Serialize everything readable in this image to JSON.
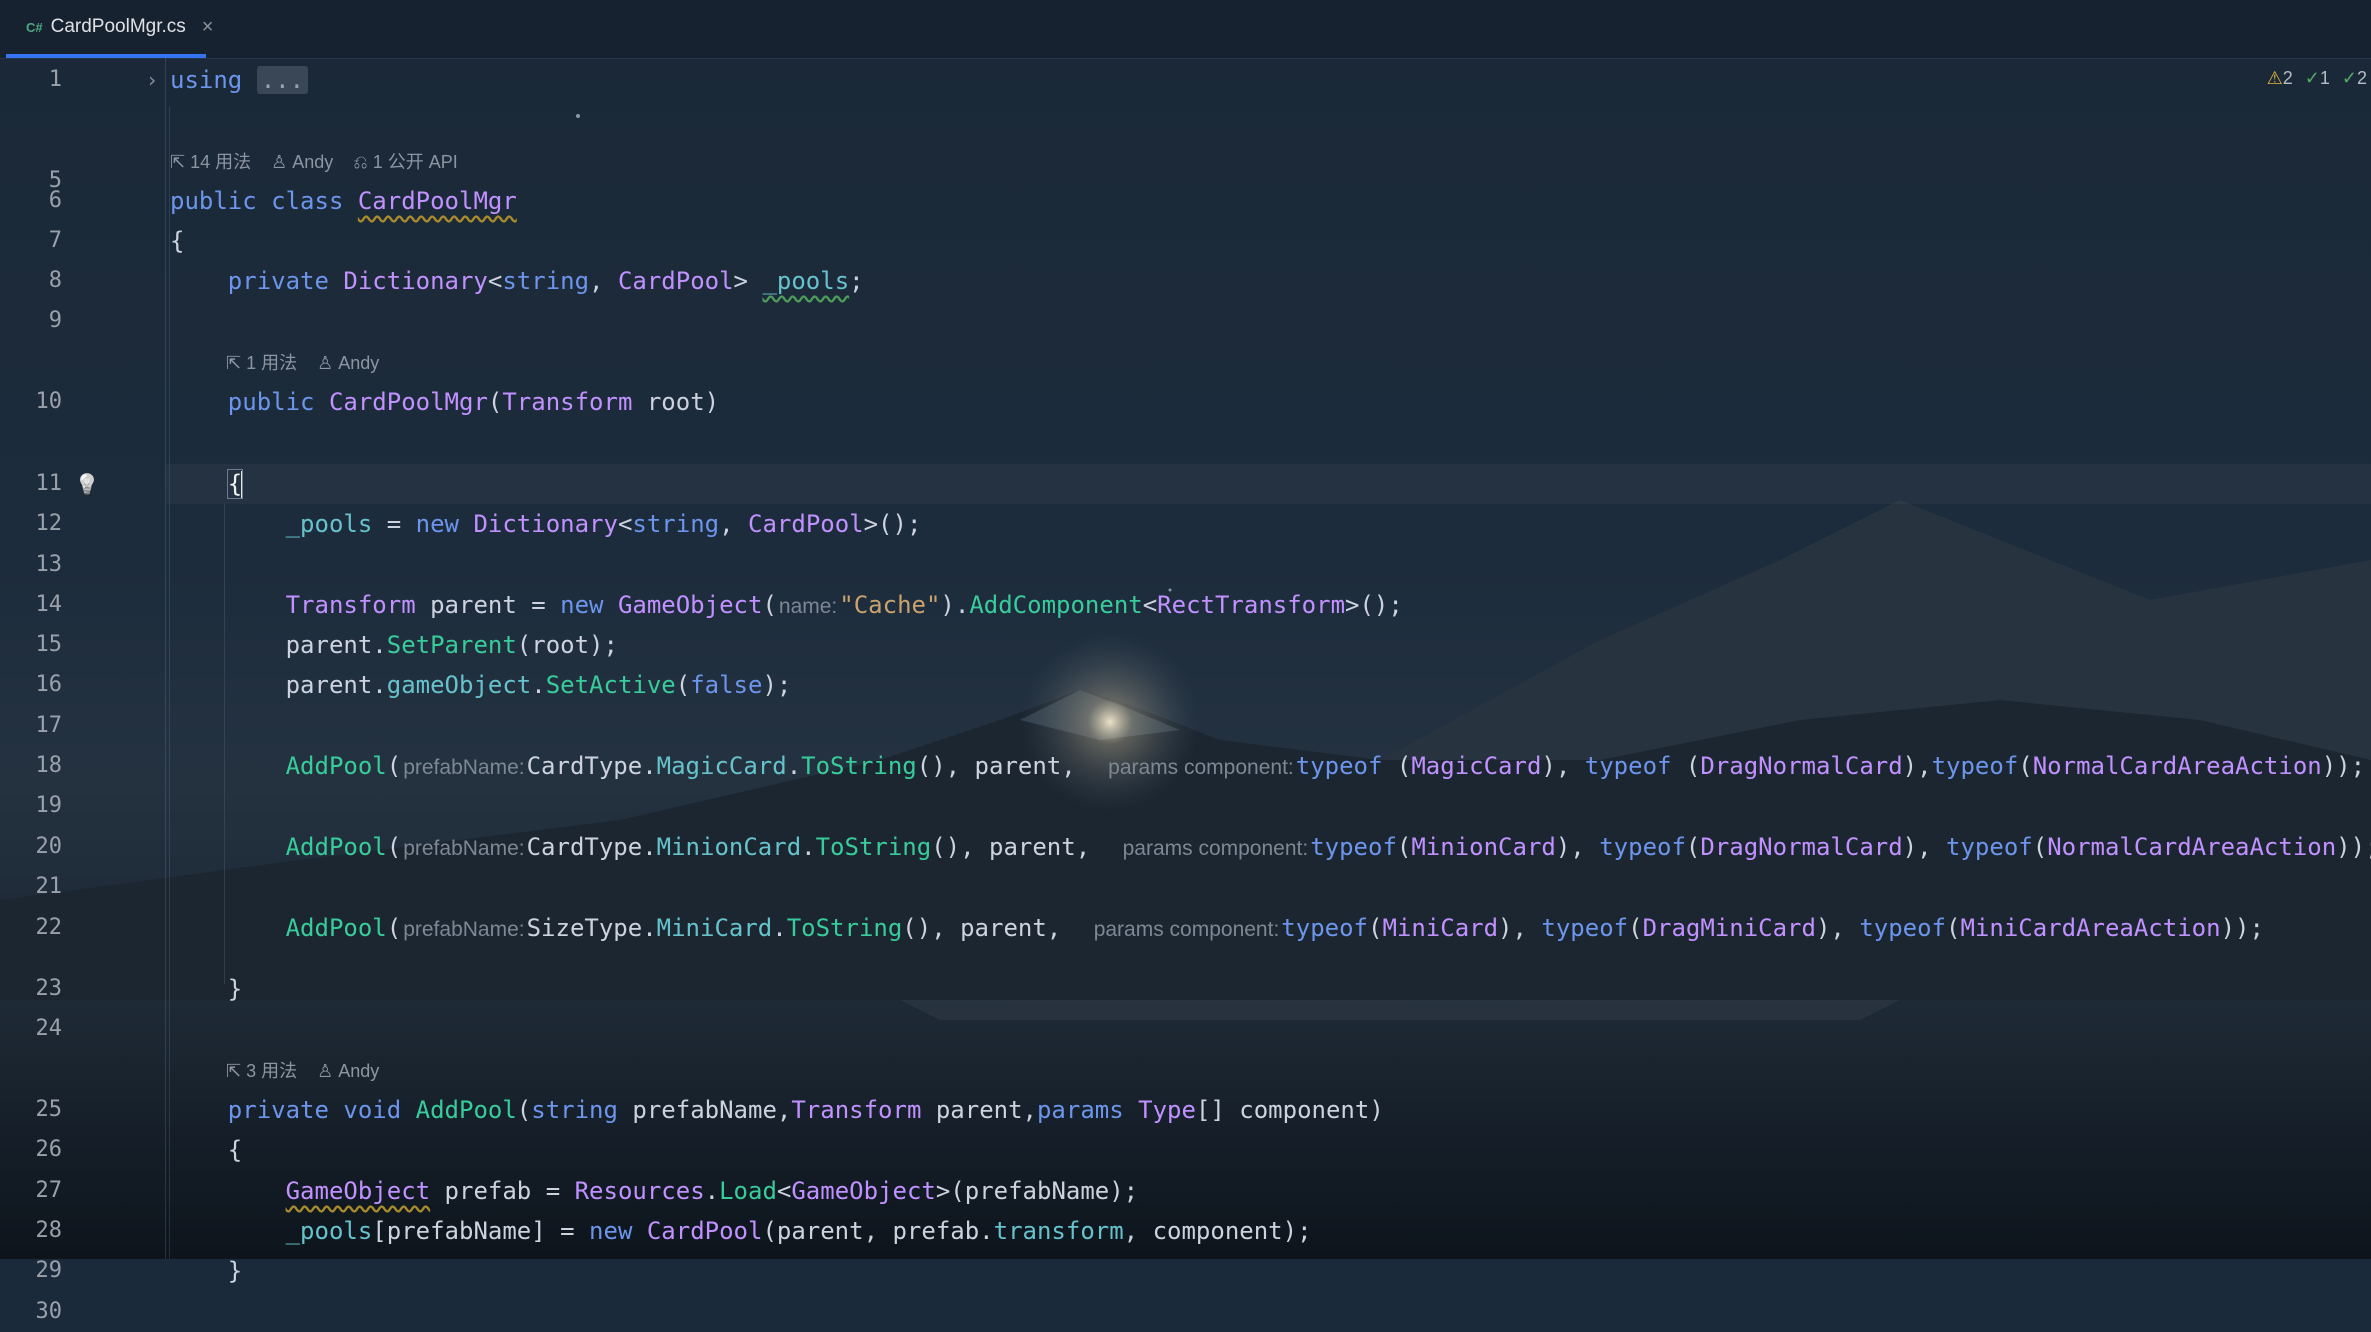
{
  "tab": {
    "icon": "C#",
    "filename": "CardPoolMgr.cs",
    "close": "×"
  },
  "inspections": {
    "warnings": "2",
    "weak_warnings": "1",
    "typos": "2"
  },
  "gutter": {
    "line_numbers": [
      "1",
      "5",
      "6",
      "7",
      "8",
      "9",
      "10",
      "11",
      "12",
      "13",
      "14",
      "15",
      "16",
      "17",
      "18",
      "19",
      "20",
      "21",
      "22",
      "23",
      "24",
      "25",
      "26",
      "27",
      "28",
      "29",
      "30"
    ]
  },
  "hints": {
    "class_usages": "14 用法",
    "class_author": "Andy",
    "class_api": "1 公开 API",
    "ctor_usages": "1 用法",
    "ctor_author": "Andy",
    "addpool_usages": "3 用法",
    "addpool_author": "Andy"
  },
  "code": {
    "l1_kw": "using",
    "l1_fold": "...",
    "l6_mod": "public class ",
    "l6_name": "CardPoolMgr",
    "l7": "{",
    "l8_mod": "private ",
    "l8_type": "Dictionary",
    "l8_rest1": "<",
    "l8_t1": "string",
    "l8_rest2": ", ",
    "l8_t2": "CardPool",
    "l8_rest3": "> ",
    "l8_field": "_pools",
    "l8_end": ";",
    "l10_mod": "public ",
    "l10_name": "CardPoolMgr",
    "l10_p": "(",
    "l10_ptype": "Transform",
    "l10_rest": " root)",
    "l11": "{",
    "l12_field": "_pools",
    "l12_eq": " = ",
    "l12_new": "new ",
    "l12_type": "Dictionary",
    "l12_lt": "<",
    "l12_t1": "string",
    "l12_comma": ", ",
    "l12_t2": "CardPool",
    "l12_end": ">();",
    "l14_type": "Transform",
    "l14_a": " parent = ",
    "l14_new": "new ",
    "l14_go": "GameObject",
    "l14_p": "(",
    "l14_hint": "name:",
    "l14_str": "\"Cache\"",
    "l14_b": ").",
    "l14_fn": "AddComponent",
    "l14_lt": "<",
    "l14_rt": "RectTransform",
    "l14_end": ">();",
    "l15_a": "parent.",
    "l15_fn": "SetParent",
    "l15_end": "(root);",
    "l16_a": "parent.",
    "l16_fld": "gameObject",
    "l16_dot": ".",
    "l16_fn": "SetActive",
    "l16_p": "(",
    "l16_kw": "false",
    "l16_end": ");",
    "l18_fn": "AddPool",
    "l18_p": "(",
    "l18_hint": "prefabName:",
    "l18_a": "CardType.",
    "l18_enum": "MagicCard",
    "l18_dot": ".",
    "l18_ts": "ToString",
    "l18_b": "(), parent, ",
    "l18_hint2": "params component:",
    "l18_to1": "typeof",
    "l18_c1": " (",
    "l18_t1": "MagicCard",
    "l18_c2": "), ",
    "l18_to2": "typeof",
    "l18_c3": " (",
    "l18_t2": "DragNormalCard",
    "l18_c4": "),",
    "l18_to3": "typeof",
    "l18_c5": "(",
    "l18_t3": "NormalCardAreaAction",
    "l18_end": "));",
    "l20_fn": "AddPool",
    "l20_p": "(",
    "l20_hint": "prefabName:",
    "l20_a": "CardType.",
    "l20_enum": "MinionCard",
    "l20_dot": ".",
    "l20_ts": "ToString",
    "l20_b": "(), parent, ",
    "l20_hint2": "params component:",
    "l20_to1": "typeof",
    "l20_c1": "(",
    "l20_t1": "MinionCard",
    "l20_c2": "), ",
    "l20_to2": "typeof",
    "l20_c3": "(",
    "l20_t2": "DragNormalCard",
    "l20_c4": "), ",
    "l20_to3": "typeof",
    "l20_c5": "(",
    "l20_t3": "NormalCardAreaAction",
    "l20_end": "));",
    "l22_fn": "AddPool",
    "l22_p": "(",
    "l22_hint": "prefabName:",
    "l22_a": "SizeType.",
    "l22_enum": "MiniCard",
    "l22_dot": ".",
    "l22_ts": "ToString",
    "l22_b": "(), parent, ",
    "l22_hint2": "params component:",
    "l22_to1": "typeof",
    "l22_c1": "(",
    "l22_t1": "MiniCard",
    "l22_c2": "), ",
    "l22_to2": "typeof",
    "l22_c3": "(",
    "l22_t2": "DragMiniCard",
    "l22_c4": "), ",
    "l22_to3": "typeof",
    "l22_c5": "(",
    "l22_t3": "MiniCardAreaAction",
    "l22_end": "));",
    "l23": "}",
    "l25_mod": "private void ",
    "l25_fn": "AddPool",
    "l25_p": "(",
    "l25_t1": "string",
    "l25_a": " prefabName,",
    "l25_t2": "Transform",
    "l25_b": " parent,",
    "l25_kw": "params",
    "l25_sp": " ",
    "l25_t3": "Type",
    "l25_end": "[] component)",
    "l26": "{",
    "l27_t": "GameObject",
    "l27_a": " prefab = ",
    "l27_res": "Resources",
    "l27_dot": ".",
    "l27_fn": "Load",
    "l27_lt": "<",
    "l27_t2": "GameObject",
    "l27_end": ">(prefabName);",
    "l28_fld": "_pools",
    "l28_a": "[prefabName] = ",
    "l28_new": "new ",
    "l28_t": "CardPool",
    "l28_b": "(parent, prefab.",
    "l28_fld2": "transform",
    "l28_end": ", component);",
    "l29": "}"
  }
}
